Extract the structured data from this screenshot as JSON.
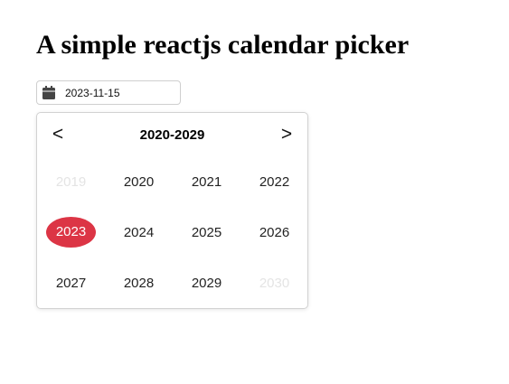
{
  "page": {
    "title": "A simple reactjs calendar picker"
  },
  "date_input": {
    "icon": "calendar-icon",
    "value": "2023-11-15"
  },
  "picker": {
    "prev_label": "<",
    "next_label": ">",
    "decade_label": "2020-2029",
    "selected_color": "#dc3545",
    "years": [
      {
        "label": "2019",
        "state": "outside"
      },
      {
        "label": "2020",
        "state": "normal"
      },
      {
        "label": "2021",
        "state": "normal"
      },
      {
        "label": "2022",
        "state": "normal"
      },
      {
        "label": "2023",
        "state": "selected"
      },
      {
        "label": "2024",
        "state": "normal"
      },
      {
        "label": "2025",
        "state": "normal"
      },
      {
        "label": "2026",
        "state": "normal"
      },
      {
        "label": "2027",
        "state": "normal"
      },
      {
        "label": "2028",
        "state": "normal"
      },
      {
        "label": "2029",
        "state": "normal"
      },
      {
        "label": "2030",
        "state": "outside"
      }
    ]
  }
}
